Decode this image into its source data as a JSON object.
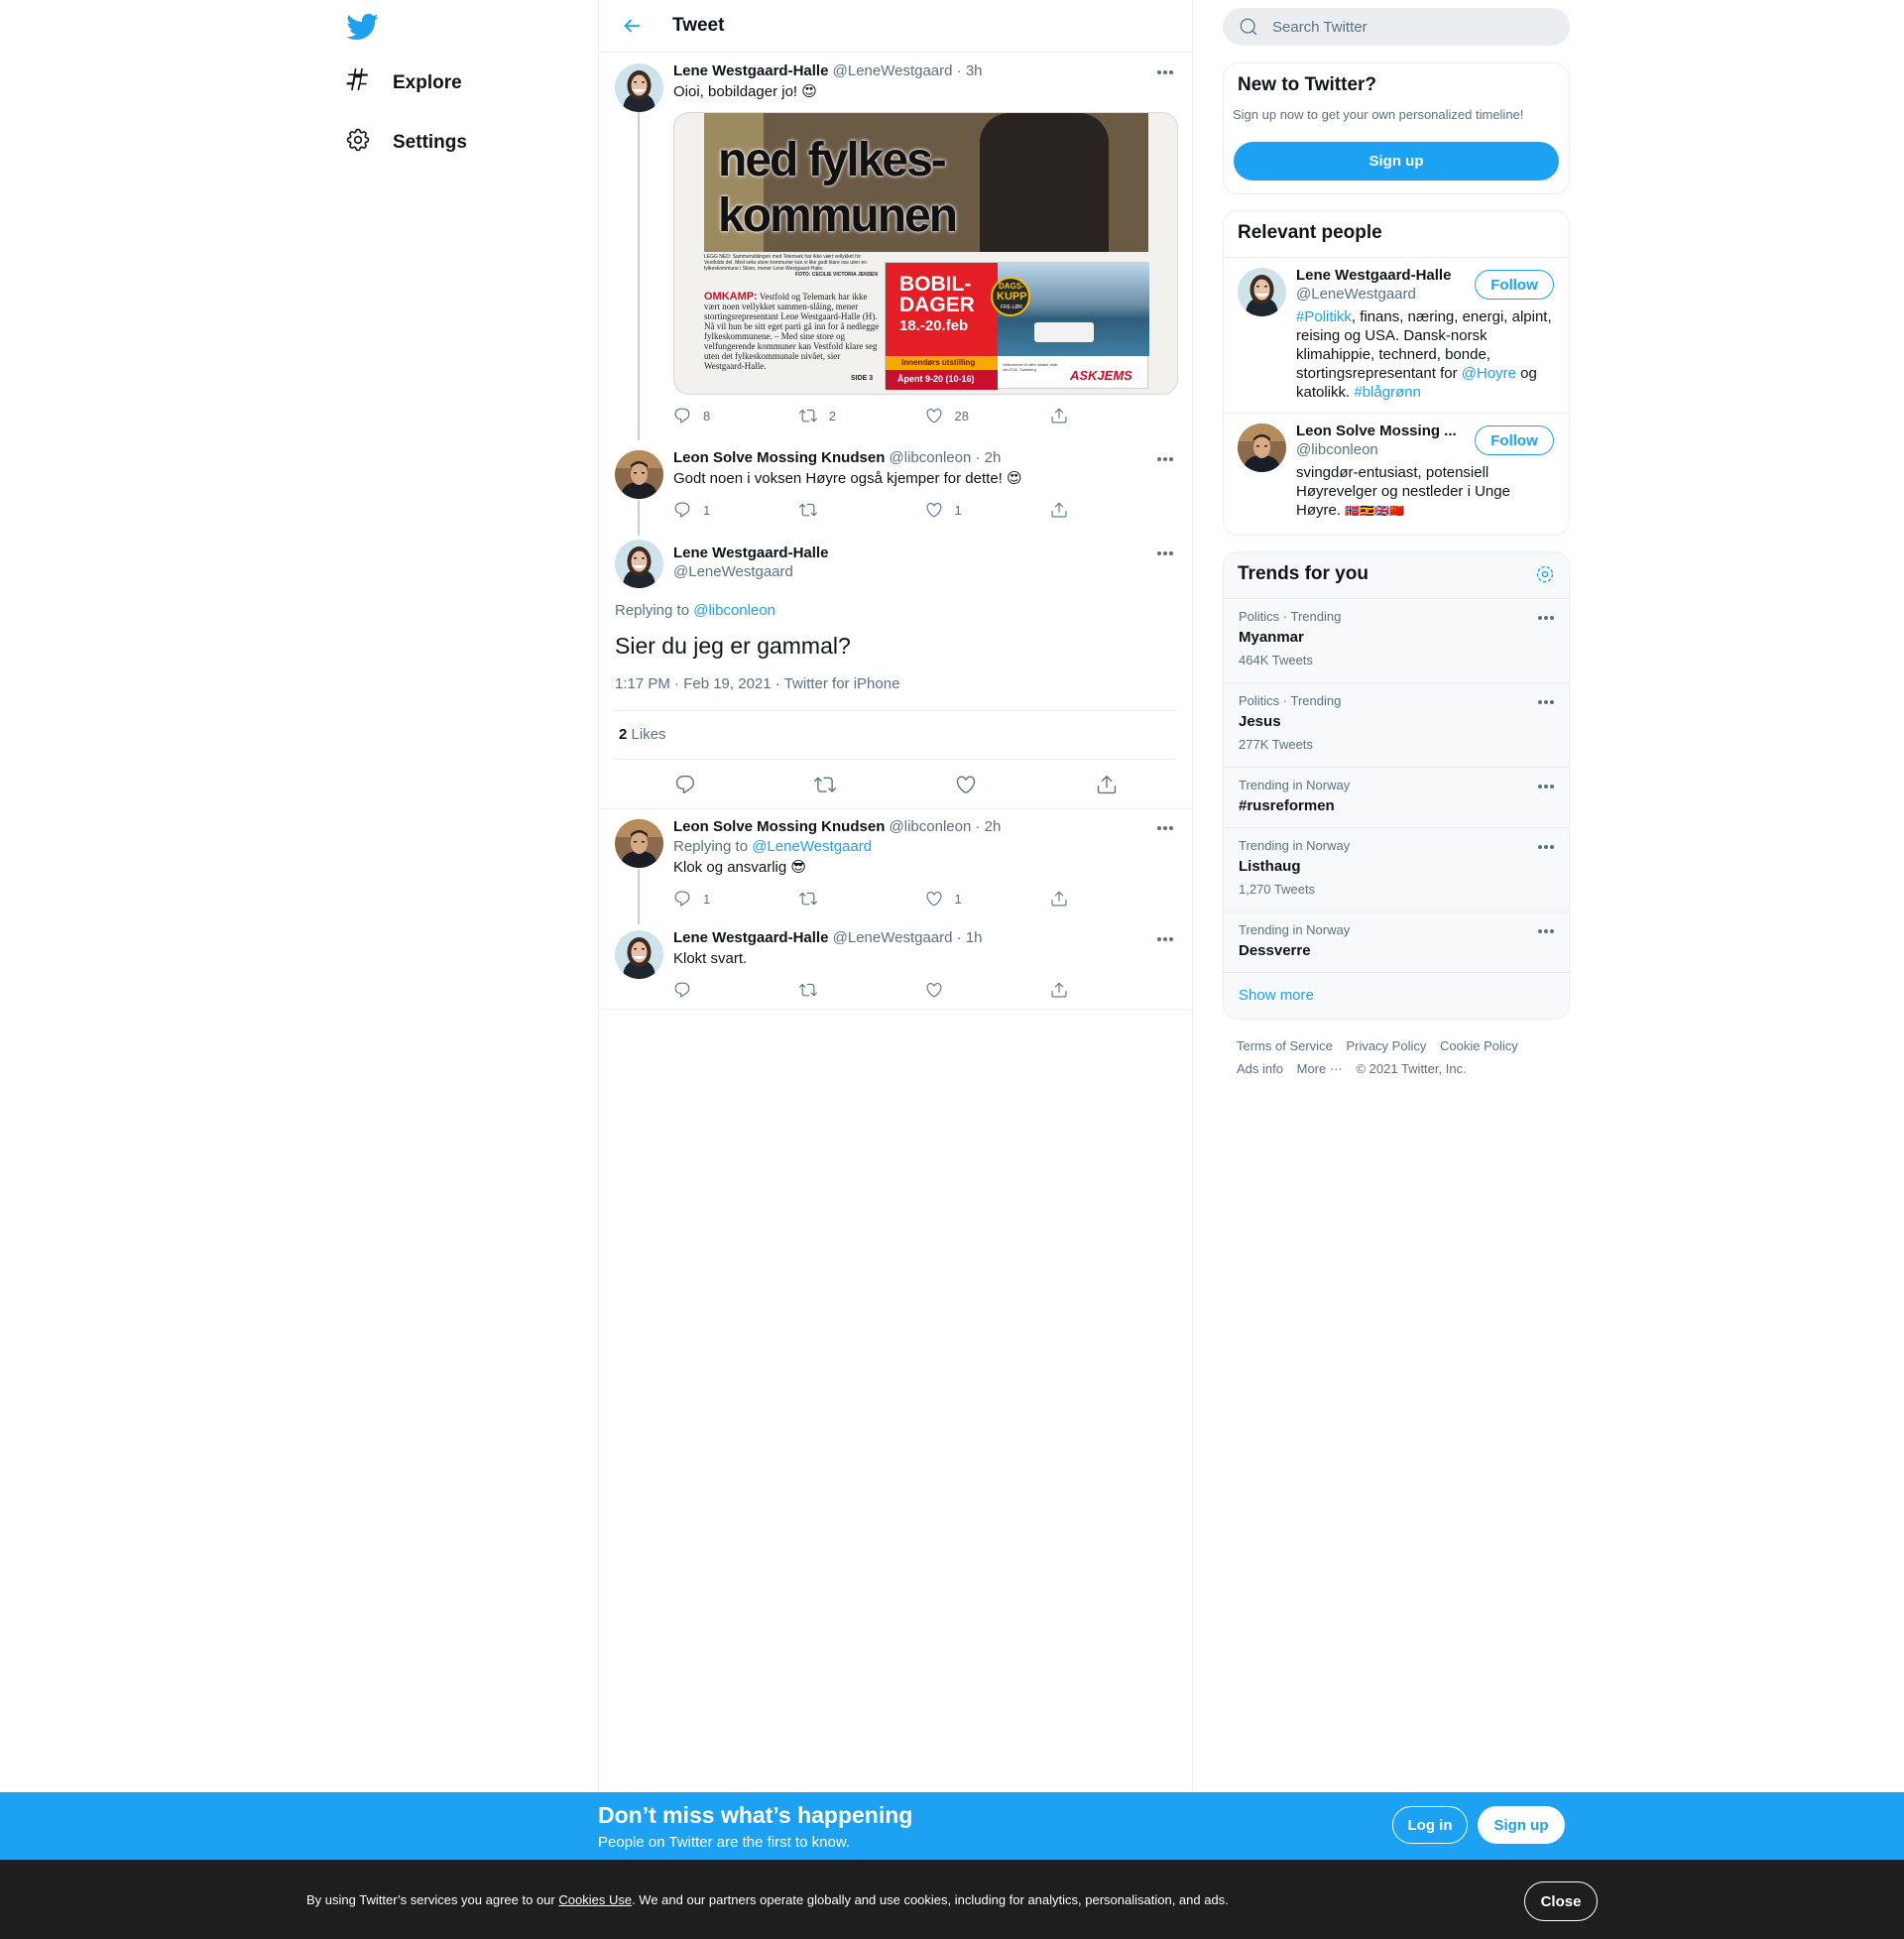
{
  "nav": {
    "explore_label": "Explore",
    "settings_label": "Settings"
  },
  "header": {
    "title": "Tweet"
  },
  "tweets": [
    {
      "name": "Lene Westgaard-Halle",
      "handle": "@LeneWestgaard",
      "time": "· 3h",
      "text": "Oioi, bobildager jo!",
      "emoji": "😍",
      "media": {
        "headline_1": "ned fylkes-",
        "headline_2": "kommunen",
        "caption": "LEGG NED: Sammenslåingen med Telemark har ikke vært vellykket for Vestfolds del. Med seks store kommuner kan vi like godt klare oss uten en fylkeskommune i Skien, mener Lene Westgaard-Halle.",
        "photo_credit": "FOTO: CECILIE VICTORIA JENSEN",
        "omkamp_label": "OMKAMP:",
        "omkamp_text": "Vestfold og Telemark har ikke vært noen vellykket sammen-slåing, mener stortingsrepresentant Lene Westgaard-Halle (H). Nå vil hun be sitt eget parti gå inn for å nedlegge fylkeskommunene. – Med sine store og velfungerende kommuner kan Vestfold klare seg uten det fylkeskommunale nivået, sier Westgaard-Halle.",
        "side": "SIDE 3",
        "ad_title_1": "BOBIL-",
        "ad_title_2": "DAGER",
        "ad_dates": "18.-20.feb",
        "ad_badge_1": "DAGS-",
        "ad_badge_2": "KUPP",
        "ad_badge_3": "FRE-LØR",
        "ad_strip": "Innendørs utstilling",
        "ad_hours": "Åpent 9-20 (10-16)",
        "ad_small": "Velkommen til våre lokaler midt ved E18, Tønsberg",
        "ad_brand": "ASKJEMS"
      },
      "replies": "8",
      "retweets": "2",
      "likes": "28"
    },
    {
      "name": "Leon Solve Mossing Knudsen",
      "handle": "@libconleon",
      "time": "· 2h",
      "text": "Godt noen i voksen Høyre også kjemper for dette!",
      "emoji": "😍",
      "replies": "1",
      "retweets": "",
      "likes": "1"
    }
  ],
  "main_tweet": {
    "name": "Lene Westgaard-Halle",
    "handle": "@LeneWestgaard",
    "replying_prefix": "Replying to",
    "replying_to": "@libconleon",
    "text": "Sier du jeg er gammal?",
    "timestamp": "1:17 PM · Feb 19, 2021",
    "sep": "·",
    "source": "Twitter for iPhone",
    "likes_count": "2",
    "likes_label": "Likes"
  },
  "replies": [
    {
      "name": "Leon Solve Mossing Knudsen",
      "handle": "@libconleon",
      "time": "· 2h",
      "replying_prefix": "Replying to",
      "replying_to": "@LeneWestgaard",
      "text": "Klok og ansvarlig",
      "emoji": "😎",
      "replies": "1",
      "retweets": "",
      "likes": "1"
    },
    {
      "name": "Lene Westgaard-Halle",
      "handle": "@LeneWestgaard",
      "time": "· 1h",
      "text": "Klokt svart.",
      "replies": "",
      "retweets": "",
      "likes": ""
    }
  ],
  "search": {
    "placeholder": "Search Twitter"
  },
  "new_to_twitter": {
    "title": "New to Twitter?",
    "subtitle": "Sign up now to get your own personalized timeline!",
    "signup_label": "Sign up"
  },
  "relevant_people": {
    "title": "Relevant people",
    "follow_label": "Follow",
    "people": [
      {
        "name": "Lene Westgaard-Halle",
        "handle": "@LeneWestgaard",
        "bio_tag1": "#Politikk",
        "bio_text1": ", finans, næring, energi, alpint, reising og USA. Dansk-norsk klimahippie, technerd, bonde, stortingsrepresentant for ",
        "bio_mention": "@Hoyre",
        "bio_text2": " og katolikk. ",
        "bio_tag2": "#blågrønn"
      },
      {
        "name": "Leon Solve Mossing ...",
        "handle": "@libconleon",
        "bio": "svingdør-entusiast, potensiell Høyrevelger og nestleder i Unge Høyre.",
        "flags": "🇳🇴🇺🇬🇬🇧🇨🇳"
      }
    ]
  },
  "trends": {
    "title": "Trends for you",
    "items": [
      {
        "context": "Politics · Trending",
        "name": "Myanmar",
        "count": "464K Tweets"
      },
      {
        "context": "Politics · Trending",
        "name": "Jesus",
        "count": "277K Tweets"
      },
      {
        "context": "Trending in Norway",
        "name": "#rusreformen",
        "count": ""
      },
      {
        "context": "Trending in Norway",
        "name": "Listhaug",
        "count": "1,270 Tweets"
      },
      {
        "context": "Trending in Norway",
        "name": "Dessverre",
        "count": ""
      }
    ],
    "show_more": "Show more"
  },
  "footer": {
    "terms": "Terms of Service",
    "privacy": "Privacy Policy",
    "cookie": "Cookie Policy",
    "ads": "Ads info",
    "more": "More ···",
    "copyright": "© 2021 Twitter, Inc."
  },
  "bottom_bar": {
    "title": "Don’t miss what’s happening",
    "subtitle": "People on Twitter are the first to know.",
    "login_label": "Log in",
    "signup_label": "Sign up"
  },
  "cookie_bar": {
    "text_before": "By using Twitter’s services you agree to our ",
    "link": "Cookies Use",
    "text_after": ". We and our partners operate globally and use cookies, including for analytics, personalisation, and ads.",
    "close_label": "Close"
  },
  "colors": {
    "accent": "#1da1f2",
    "text": "#0f1419",
    "secondary_text": "#5b7083",
    "border": "#ebeef0",
    "cookie_bg": "#1e1e1e"
  }
}
